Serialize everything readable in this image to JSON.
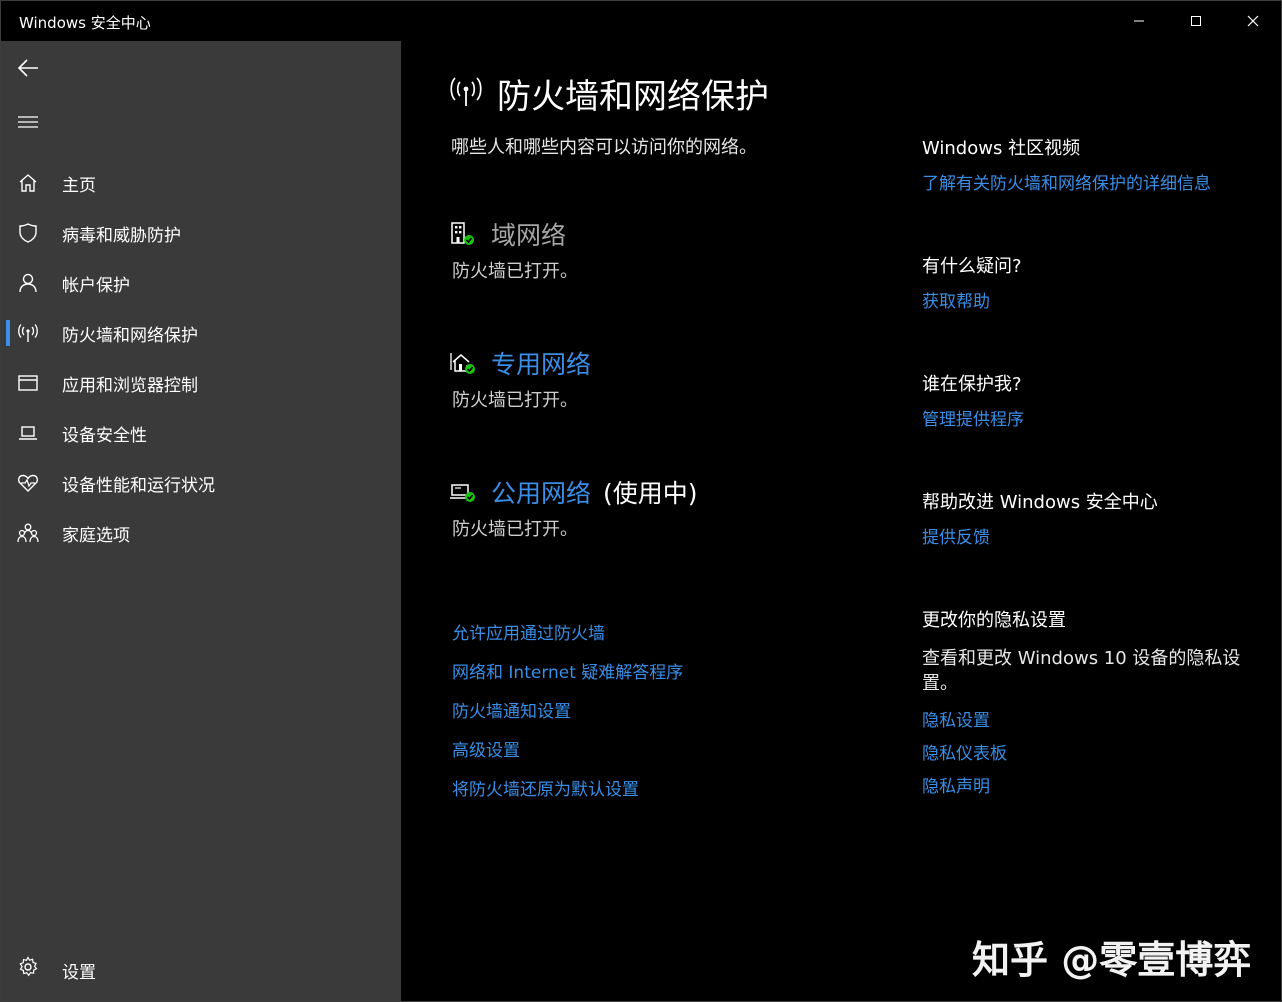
{
  "window": {
    "title": "Windows 安全中心"
  },
  "sidebar": {
    "items": [
      {
        "label": "主页",
        "icon": "home-icon"
      },
      {
        "label": "病毒和威胁防护",
        "icon": "shield-icon"
      },
      {
        "label": "帐户保护",
        "icon": "person-icon"
      },
      {
        "label": "防火墙和网络保护",
        "icon": "antenna-icon",
        "selected": true
      },
      {
        "label": "应用和浏览器控制",
        "icon": "browser-window-icon"
      },
      {
        "label": "设备安全性",
        "icon": "laptop-icon"
      },
      {
        "label": "设备性能和运行状况",
        "icon": "heart-pulse-icon"
      },
      {
        "label": "家庭选项",
        "icon": "family-icon"
      }
    ],
    "settings_label": "设置"
  },
  "main": {
    "title": "防火墙和网络保护",
    "subtitle": "哪些人和哪些内容可以访问你的网络。",
    "networks": [
      {
        "name": "域网络",
        "status": "防火墙已打开。",
        "icon": "domain-network-icon",
        "suffix": ""
      },
      {
        "name": "专用网络",
        "status": "防火墙已打开。",
        "icon": "private-network-icon",
        "suffix": ""
      },
      {
        "name": "公用网络",
        "status": "防火墙已打开。",
        "icon": "public-network-icon",
        "suffix": "(使用中)"
      }
    ],
    "links": [
      "允许应用通过防火墙",
      "网络和 Internet 疑难解答程序",
      "防火墙通知设置",
      "高级设置",
      "将防火墙还原为默认设置"
    ]
  },
  "side_panel": {
    "community_heading": "Windows 社区视频",
    "community_link": "了解有关防火墙和网络保护的详细信息",
    "question_heading": "有什么疑问?",
    "question_link": "获取帮助",
    "who_heading": "谁在保护我?",
    "who_link": "管理提供程序",
    "improve_heading": "帮助改进 Windows 安全中心",
    "improve_link": "提供反馈",
    "privacy_heading": "更改你的隐私设置",
    "privacy_text": "查看和更改 Windows 10 设备的隐私设置。",
    "privacy_links": [
      "隐私设置",
      "隐私仪表板",
      "隐私声明"
    ]
  },
  "watermark": "知乎 @零壹博弈",
  "colors": {
    "accent": "#3a8ee6",
    "sidebar_bg": "#3a3a3a",
    "main_bg": "#000000",
    "status_ok": "#16c60c"
  }
}
